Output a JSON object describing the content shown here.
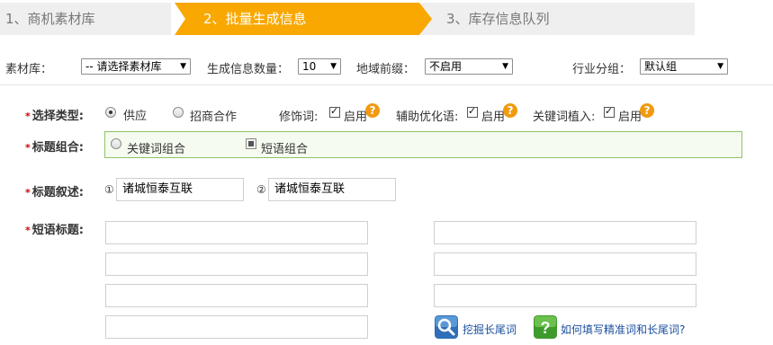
{
  "steps": [
    {
      "label": "1、商机素材库"
    },
    {
      "label": "2、批量生成信息"
    },
    {
      "label": "3、库存信息队列"
    }
  ],
  "filters": {
    "material_label": "素材库：",
    "material_value": "-- 请选择素材库",
    "count_label": "生成信息数量：",
    "count_value": "10",
    "region_label": "地域前缀：",
    "region_value": "不启用",
    "industry_label": "行业分组：",
    "industry_value": "默认组"
  },
  "select_type": {
    "label": "选择类型:",
    "option_supply": "供应",
    "option_invest": "招商合作",
    "modifier_label": "修饰词:",
    "modifier_enable": "启用",
    "aux_label": "辅助优化语:",
    "aux_enable": "启用",
    "keyword_label": "关键词植入:",
    "keyword_enable": "启用",
    "help": "?"
  },
  "title_combo": {
    "label": "标题组合:",
    "option_keyword": "关键词组合",
    "option_phrase": "短语组合"
  },
  "title_desc": {
    "label": "标题叙述:",
    "marker1": "①",
    "value1": "诸城恒泰互联",
    "marker2": "②",
    "value2": "诸城恒泰互联"
  },
  "phrase_title": {
    "label": "短语标题:"
  },
  "links": {
    "mine_longtail": "挖掘长尾词",
    "how_to_fill": "如何填写精准词和长尾词?",
    "help_glyph": "?"
  },
  "colors": {
    "active_step": "#f8a800",
    "inactive_step": "#efefef",
    "required": "#d40000",
    "help_icon": "#f19a0e",
    "green_box_border": "#8fc26a",
    "link": "#1a4e9e"
  }
}
